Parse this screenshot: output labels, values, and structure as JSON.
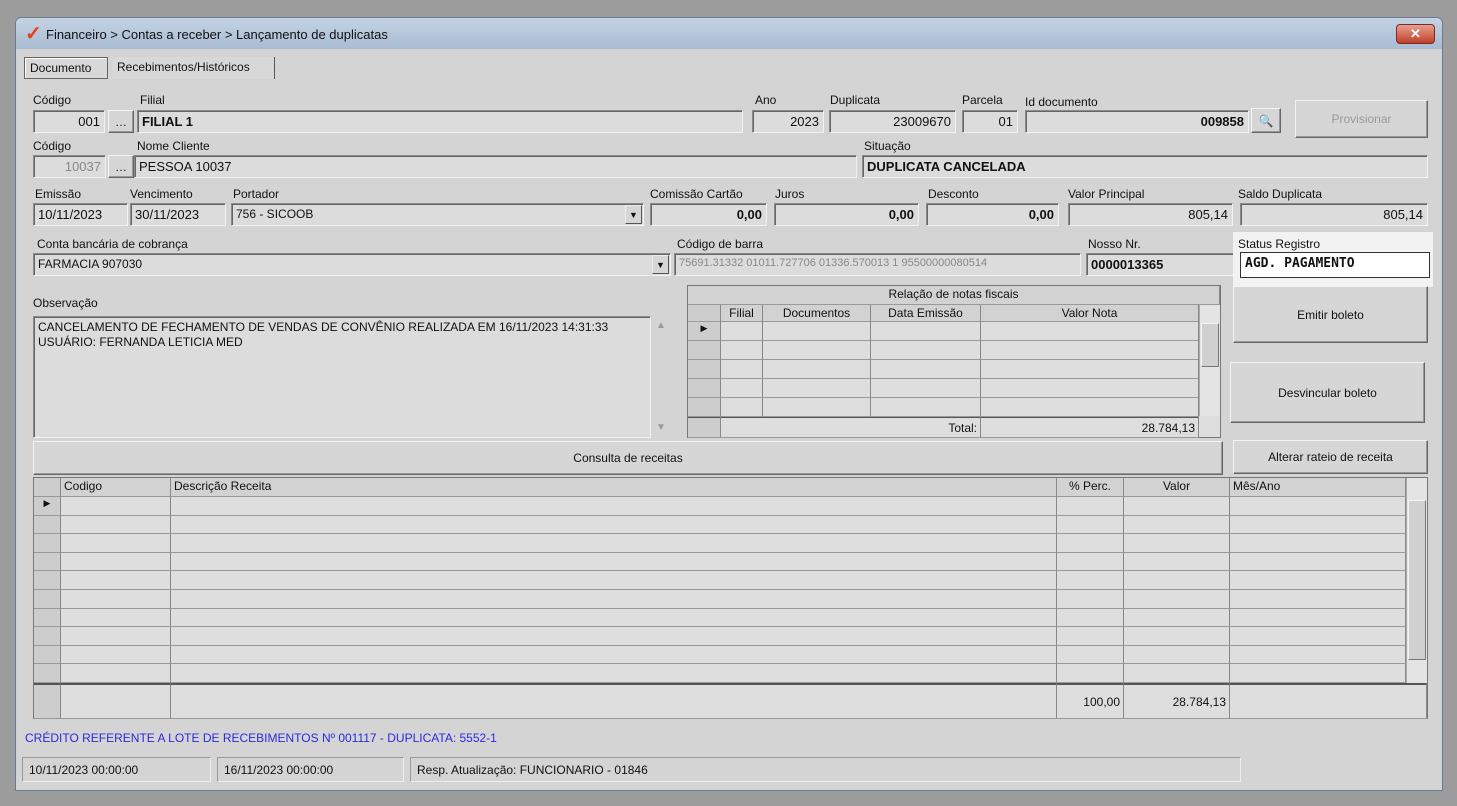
{
  "window": {
    "title": "Financeiro > Contas a receber > Lançamento de duplicatas",
    "close_label": "✕"
  },
  "tabs": [
    {
      "label": "Documento"
    },
    {
      "label": "Recebimentos/Históricos"
    }
  ],
  "form": {
    "codigo_filial": {
      "label": "Código",
      "value": "001"
    },
    "filial": {
      "label": "Filial",
      "value": "FILIAL 1"
    },
    "ano": {
      "label": "Ano",
      "value": "2023"
    },
    "duplicata": {
      "label": "Duplicata",
      "value": "23009670"
    },
    "parcela": {
      "label": "Parcela",
      "value": "01"
    },
    "id_documento": {
      "label": "Id documento",
      "value": "009858"
    },
    "provisionar_label": "Provisionar",
    "codigo_cliente": {
      "label": "Código",
      "value": "10037"
    },
    "nome_cliente": {
      "label": "Nome Cliente",
      "value": "PESSOA 10037"
    },
    "situacao": {
      "label": "Situação",
      "value": "DUPLICATA CANCELADA"
    },
    "emissao": {
      "label": "Emissão",
      "value": "10/11/2023"
    },
    "vencimento": {
      "label": "Vencimento",
      "value": "30/11/2023"
    },
    "portador": {
      "label": "Portador",
      "value": "756 - SICOOB"
    },
    "comissao": {
      "label": "Comissão Cartão",
      "value": "0,00"
    },
    "juros": {
      "label": "Juros",
      "value": "0,00"
    },
    "desconto": {
      "label": "Desconto",
      "value": "0,00"
    },
    "valor_principal": {
      "label": "Valor Principal",
      "value": "805,14"
    },
    "saldo_duplicata": {
      "label": "Saldo Duplicata",
      "value": "805,14"
    },
    "conta_bancaria": {
      "label": "Conta bancária de cobrança",
      "value": "FARMACIA 907030"
    },
    "codigo_barra": {
      "label": "Código de barra",
      "value": "75691.31332 01011.727706 01336.570013 1 95500000080514"
    },
    "nosso_nr": {
      "label": "Nosso Nr.",
      "value": "0000013365"
    },
    "status_registro": {
      "label": "Status Registro",
      "value": "AGD. PAGAMENTO"
    },
    "observacao": {
      "label": "Observação",
      "value": "CANCELAMENTO DE FECHAMENTO DE VENDAS DE CONVÊNIO REALIZADA EM  16/11/2023 14:31:33 USUÁRIO: FERNANDA LETICIA MED"
    }
  },
  "notas": {
    "title": "Relação de notas fiscais",
    "columns": [
      "Filial",
      "Documentos",
      "Data Emissão",
      "Valor Nota"
    ],
    "total_label": "Total:",
    "total_value": "28.784,13"
  },
  "buttons": {
    "emitir": "Emitir boleto",
    "desvincular": "Desvincular boleto",
    "alterar": "Alterar rateio de receita",
    "consulta": "Consulta de receitas"
  },
  "receitas": {
    "columns": [
      "Codigo",
      "Descrição Receita",
      "% Perc.",
      "Valor",
      "Mês/Ano"
    ],
    "total_perc": "100,00",
    "total_valor": "28.784,13"
  },
  "status_message": "CRÉDITO REFERENTE A LOTE DE RECEBIMENTOS Nº 001117 - DUPLICATA: 5552-1",
  "statusbar": [
    "10/11/2023 00:00:00",
    "16/11/2023 00:00:00",
    "Resp. Atualização: FUNCIONARIO - 01846"
  ],
  "colors": {
    "status_message": "#2a2ae0",
    "highlight_bg": "#f2f2f2"
  }
}
